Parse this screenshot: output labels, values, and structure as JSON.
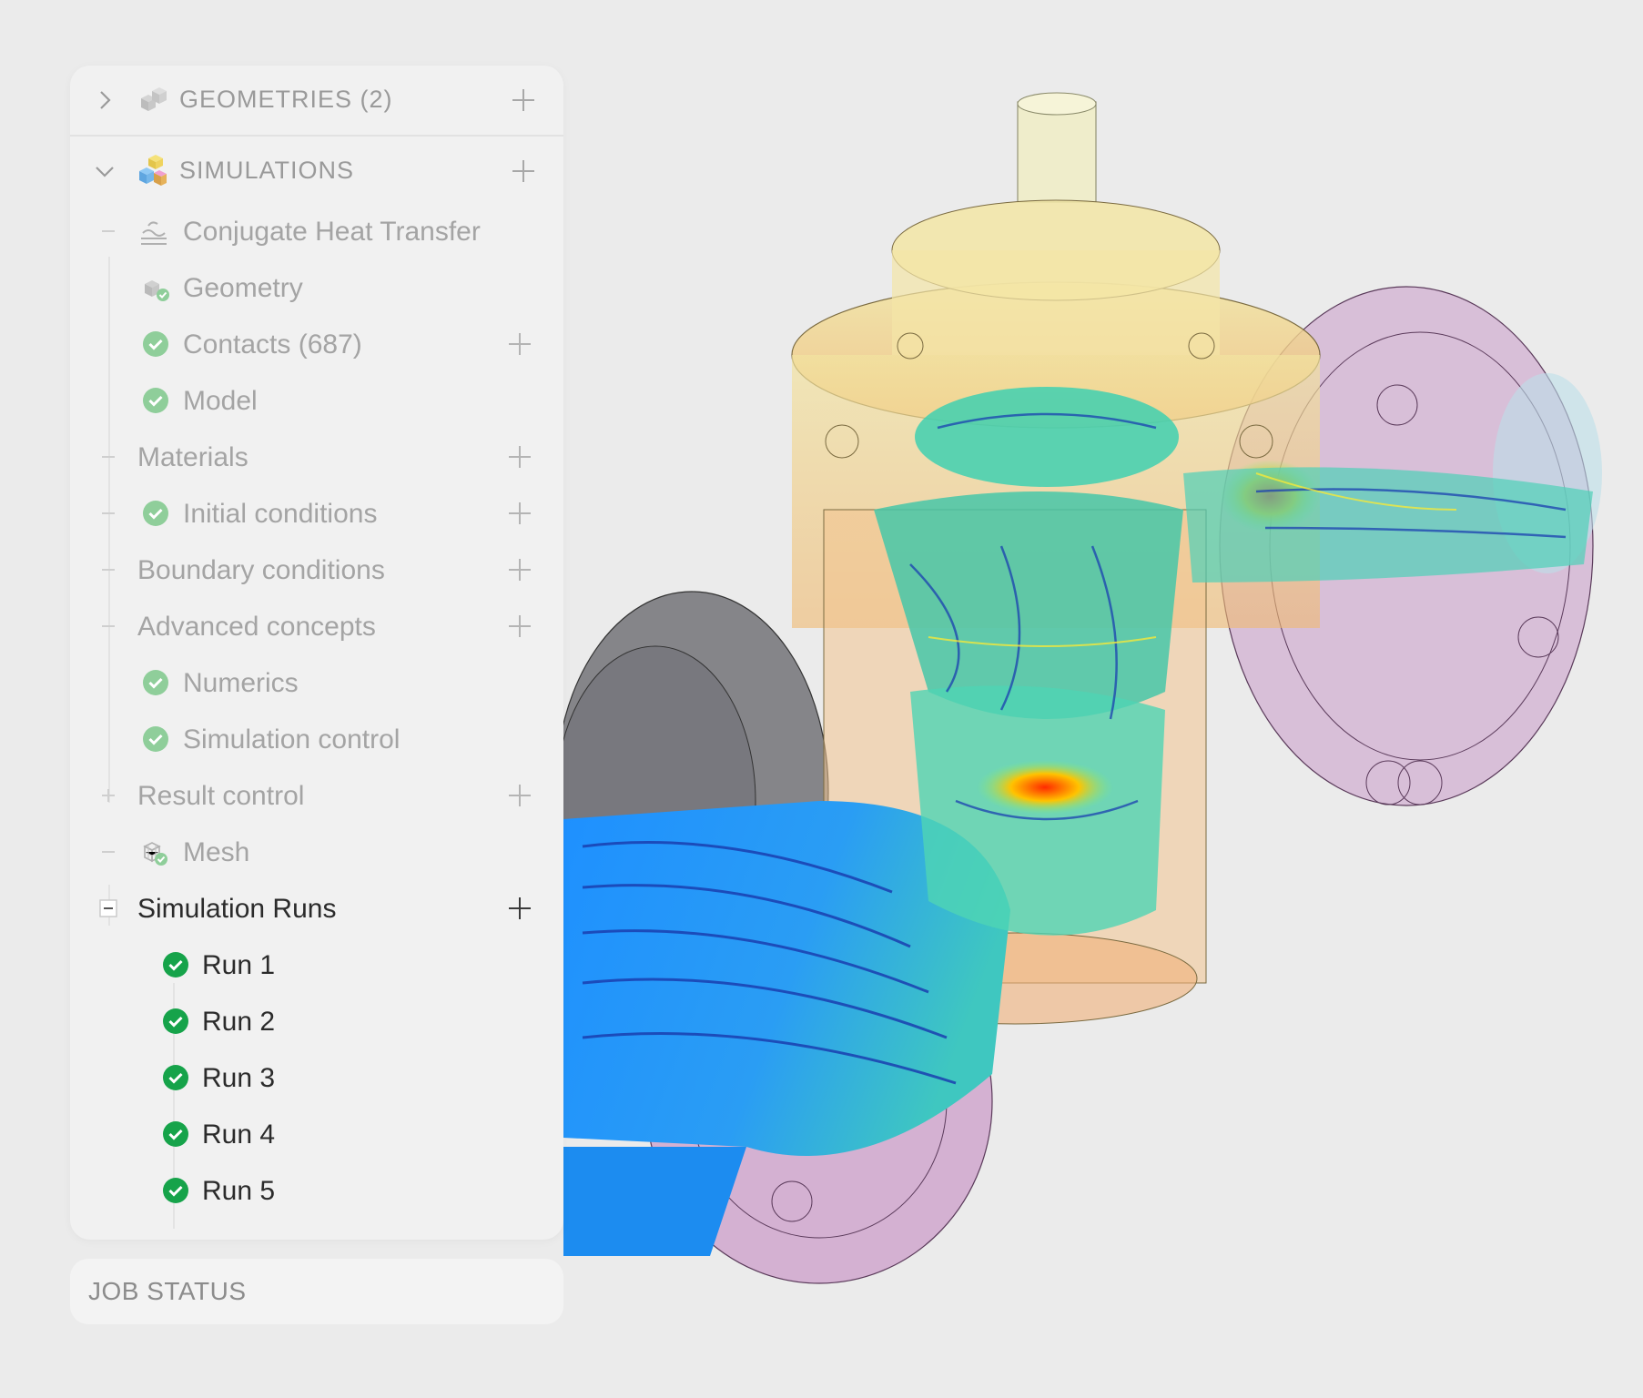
{
  "tree": {
    "geometries": {
      "label": "GEOMETRIES (2)",
      "expanded": false
    },
    "simulations": {
      "label": "SIMULATIONS",
      "expanded": true,
      "items": [
        {
          "label": "Conjugate Heat Transfer",
          "toggle": "minus",
          "icon": "heat-transfer-icon",
          "has_add": false
        },
        {
          "label": "Geometry",
          "icon": "geometry-check-icon",
          "has_add": false
        },
        {
          "label": "Contacts (687)",
          "icon": "check-circle-icon",
          "has_add": true
        },
        {
          "label": "Model",
          "icon": "check-circle-icon",
          "has_add": false
        },
        {
          "label": "Materials",
          "toggle": "minus",
          "has_add": true
        },
        {
          "label": "Initial conditions",
          "toggle": "minus",
          "icon": "check-circle-icon",
          "has_add": true
        },
        {
          "label": "Boundary conditions",
          "toggle": "minus",
          "has_add": true
        },
        {
          "label": "Advanced concepts",
          "toggle": "minus",
          "has_add": true
        },
        {
          "label": "Numerics",
          "icon": "check-circle-icon",
          "has_add": false
        },
        {
          "label": "Simulation control",
          "icon": "check-circle-icon",
          "has_add": false
        },
        {
          "label": "Result control",
          "toggle": "plus",
          "has_add": true
        },
        {
          "label": "Mesh",
          "toggle": "minus",
          "icon": "mesh-icon",
          "has_add": false
        },
        {
          "label": "Simulation Runs",
          "toggle": "minus",
          "has_add": true,
          "active": true
        }
      ],
      "runs": [
        {
          "label": "Run 1",
          "status": "complete"
        },
        {
          "label": "Run 2",
          "status": "complete"
        },
        {
          "label": "Run 3",
          "status": "complete"
        },
        {
          "label": "Run 4",
          "status": "complete"
        },
        {
          "label": "Run 5",
          "status": "complete"
        }
      ]
    }
  },
  "job_status": {
    "label": "JOB STATUS"
  },
  "colors": {
    "panel_bg": "#f1f1f1",
    "muted_text": "#a4a4a4",
    "active_text": "#2b2b2b",
    "success_muted": "#8fce9a",
    "success": "#16a34a"
  }
}
